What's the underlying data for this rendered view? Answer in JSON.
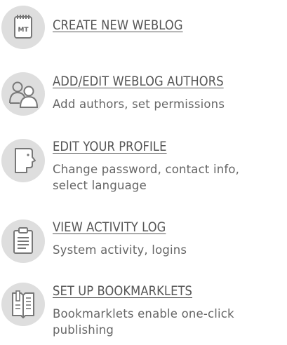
{
  "menu": {
    "items": [
      {
        "icon": "mt-notepad-icon",
        "title": "CREATE NEW WEBLOG",
        "description": ""
      },
      {
        "icon": "people-icon",
        "title": "ADD/EDIT WEBLOG AUTHORS",
        "description": "Add authors, set permissions"
      },
      {
        "icon": "profile-head-icon",
        "title": "EDIT YOUR PROFILE",
        "description": "Change password, contact info, select language"
      },
      {
        "icon": "clipboard-icon",
        "title": "VIEW ACTIVITY LOG",
        "description": "System activity, logins"
      },
      {
        "icon": "bookmark-book-icon",
        "title": "SET UP BOOKMARKLETS",
        "description": "Bookmarklets enable one-click publishing"
      }
    ]
  },
  "colors": {
    "icon_background": "#dedede",
    "icon_stroke": "#777777",
    "title_text": "#555555",
    "description_text": "#666666"
  }
}
